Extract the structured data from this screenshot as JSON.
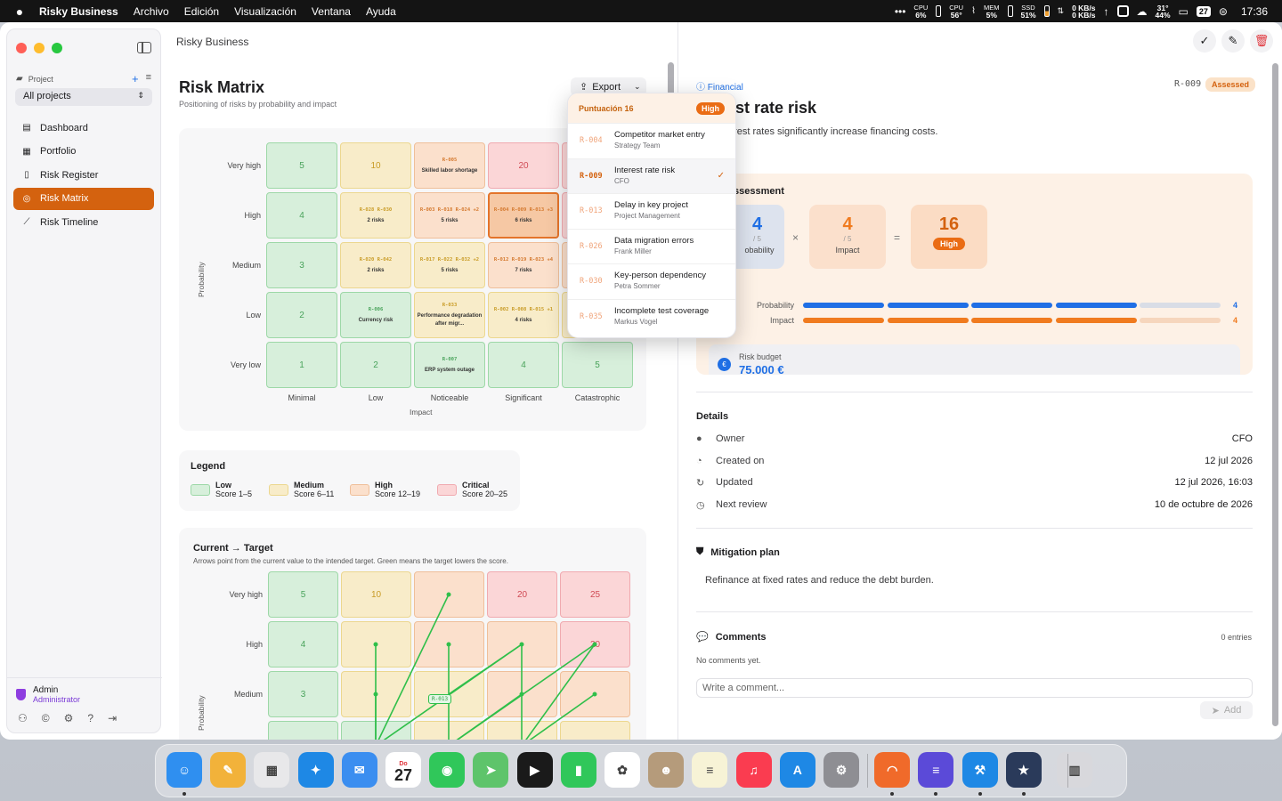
{
  "menubar": {
    "app": "Risky Business",
    "menus": [
      "Archivo",
      "Edición",
      "Visualización",
      "Ventana",
      "Ayuda"
    ],
    "stats": [
      {
        "label": "CPU",
        "value": "6%"
      },
      {
        "label": "CPU",
        "value": "56°"
      },
      {
        "label": "MEM",
        "value": "5%"
      },
      {
        "label": "SSD",
        "value": "51%"
      }
    ],
    "net_up": "0 KB/s",
    "net_down": "0 KB/s",
    "weather_temp": "31°",
    "weather_hum": "44%",
    "cal_day": "27",
    "clock": "17:36"
  },
  "sidebar": {
    "project_label": "Project",
    "project_select": "All projects",
    "nav": [
      {
        "label": "Dashboard",
        "icon": "dashboard-icon"
      },
      {
        "label": "Portfolio",
        "icon": "grid-icon"
      },
      {
        "label": "Risk Register",
        "icon": "clipboard-icon"
      },
      {
        "label": "Risk Matrix",
        "icon": "target-icon",
        "active": true
      },
      {
        "label": "Risk Timeline",
        "icon": "chart-line-icon"
      }
    ],
    "user_name": "Admin",
    "user_role": "Administrator"
  },
  "main": {
    "breadcrumb": "Risky Business",
    "title": "Risk Matrix",
    "subtitle": "Positioning of risks by probability and impact",
    "export_label": "Export",
    "row_labels": [
      "Very high",
      "High",
      "Medium",
      "Low",
      "Very low"
    ],
    "col_labels": [
      "Minimal",
      "Low",
      "Noticeable",
      "Significant",
      "Catastrophic"
    ],
    "axis_y": "Probability",
    "axis_x": "Impact",
    "matrix": [
      [
        {
          "t": "5"
        },
        {
          "t": "10"
        },
        {
          "ids": "R-005",
          "sub": "Skilled labor shortage"
        },
        {
          "t": "20"
        },
        {
          "t": ""
        }
      ],
      [
        {
          "t": "4"
        },
        {
          "ids": "R-028 R-030",
          "sub": "2 risks"
        },
        {
          "ids": "R-003 R-018 R-024 +2",
          "sub": "5 risks"
        },
        {
          "ids": "R-004 R-009 R-013 +3",
          "sub": "6 risks"
        },
        {
          "t": ""
        }
      ],
      [
        {
          "t": "3"
        },
        {
          "ids": "R-020 R-042",
          "sub": "2 risks"
        },
        {
          "ids": "R-017 R-022 R-032 +2",
          "sub": "5 risks"
        },
        {
          "ids": "R-012 R-019 R-023 +4",
          "sub": "7 risks"
        },
        {
          "t": ""
        }
      ],
      [
        {
          "t": "2"
        },
        {
          "ids": "R-006",
          "sub": "Currency risk"
        },
        {
          "ids": "R-033",
          "sub": "Performance degradation after migr..."
        },
        {
          "ids": "R-002 R-008 R-015 +1",
          "sub": "4 risks"
        },
        {
          "t": ""
        }
      ],
      [
        {
          "t": "1"
        },
        {
          "t": "2"
        },
        {
          "ids": "R-007",
          "sub": "ERP system outage"
        },
        {
          "t": "4"
        },
        {
          "t": "5"
        }
      ]
    ],
    "legend_title": "Legend",
    "legend": [
      {
        "name": "Low",
        "range": "Score 1–5"
      },
      {
        "name": "Medium",
        "range": "Score 6–11"
      },
      {
        "name": "High",
        "range": "Score 12–19"
      },
      {
        "name": "Critical",
        "range": "Score 20–25"
      }
    ],
    "target_title": "Current → Target",
    "target_subtitle": "Arrows point from the current value to the intended target. Green means the target lowers the score.",
    "target_rows": [
      "Very high",
      "High",
      "Medium"
    ],
    "target_matrix": [
      [
        "5",
        "10",
        "",
        "20",
        "25"
      ],
      [
        "4",
        "",
        "",
        "",
        "20"
      ],
      [
        "3",
        "",
        "",
        "",
        ""
      ]
    ],
    "target_arrow_label": "R-013"
  },
  "popup": {
    "header": "Puntuación 16",
    "badge": "High",
    "items": [
      {
        "id": "R-004",
        "title": "Competitor market entry",
        "owner": "Strategy Team"
      },
      {
        "id": "R-009",
        "title": "Interest rate risk",
        "owner": "CFO",
        "selected": true
      },
      {
        "id": "R-013",
        "title": "Delay in key project",
        "owner": "Project Management"
      },
      {
        "id": "R-026",
        "title": "Data migration errors",
        "owner": "Frank Miller"
      },
      {
        "id": "R-030",
        "title": "Key-person dependency",
        "owner": "Petra Sommer"
      },
      {
        "id": "R-035",
        "title": "Incomplete test coverage",
        "owner": "Markus Vogel"
      }
    ]
  },
  "detail": {
    "category": "Financial",
    "risk_id": "R-009",
    "status": "Assessed",
    "title_visible": "est rate risk",
    "desc_visible": "erest rates significantly increase financing costs.",
    "assess_heading": "ssessment",
    "prob_value": "4",
    "prob_den": "/ 5",
    "prob_label": "obability",
    "impact_value": "4",
    "impact_den": "/ 5",
    "impact_label": "Impact",
    "score_value": "16",
    "score_label": "High",
    "bar_prob_label": "Probability",
    "bar_prob_value": "4",
    "bar_impact_label": "Impact",
    "bar_impact_value": "4",
    "budget_label": "Risk budget",
    "budget_value": "75.000 €",
    "details_heading": "Details",
    "details": [
      {
        "k": "Owner",
        "v": "CFO",
        "icon": "person-icon"
      },
      {
        "k": "Created on",
        "v": "12 jul 2026",
        "icon": "clock-icon"
      },
      {
        "k": "Updated",
        "v": "12 jul 2026, 16:03",
        "icon": "refresh-icon"
      },
      {
        "k": "Next review",
        "v": "10 de octubre de 2026",
        "icon": "history-icon"
      }
    ],
    "mitigation_heading": "Mitigation plan",
    "mitigation_text": "Refinance at fixed rates and reduce the debt burden.",
    "comments_heading": "Comments",
    "comments_count": "0 entries",
    "comments_empty": "No comments yet.",
    "comment_placeholder": "Write a comment...",
    "add_label": "Add"
  },
  "dock": {
    "cal_month": "Do",
    "cal_day": "27"
  },
  "colors": {
    "accent": "#d4620f",
    "low": "#d7efdb",
    "medium": "#f8ecc9",
    "high": "#fbe0cc",
    "critical": "#fbd6d7",
    "probability_bar": "#1f6fe5",
    "impact_bar": "#f07b1f"
  }
}
